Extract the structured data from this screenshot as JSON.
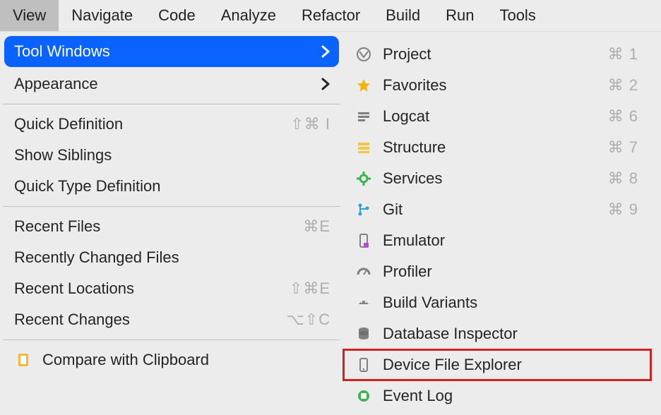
{
  "menubar": {
    "items": [
      {
        "label": "View",
        "active": true
      },
      {
        "label": "Navigate",
        "active": false
      },
      {
        "label": "Code",
        "active": false
      },
      {
        "label": "Analyze",
        "active": false
      },
      {
        "label": "Refactor",
        "active": false
      },
      {
        "label": "Build",
        "active": false
      },
      {
        "label": "Run",
        "active": false
      },
      {
        "label": "Tools",
        "active": false
      }
    ]
  },
  "left_menu": {
    "tool_windows": "Tool Windows",
    "appearance": "Appearance",
    "quick_definition": {
      "label": "Quick Definition",
      "shortcut": "⇧⌘ I"
    },
    "show_siblings": {
      "label": "Show Siblings",
      "shortcut": ""
    },
    "quick_type_definition": {
      "label": "Quick Type Definition",
      "shortcut": ""
    },
    "recent_files": {
      "label": "Recent Files",
      "shortcut": "⌘E"
    },
    "recently_changed": {
      "label": "Recently Changed Files",
      "shortcut": ""
    },
    "recent_locations": {
      "label": "Recent Locations",
      "shortcut": "⇧⌘E"
    },
    "recent_changes": {
      "label": "Recent Changes",
      "shortcut": "⌥⇧C"
    },
    "compare_clipboard": {
      "label": "Compare with Clipboard",
      "shortcut": ""
    }
  },
  "right_menu": {
    "project": {
      "label": "Project",
      "shortcut": "⌘ 1"
    },
    "favorites": {
      "label": "Favorites",
      "shortcut": "⌘ 2"
    },
    "logcat": {
      "label": "Logcat",
      "shortcut": "⌘ 6"
    },
    "structure": {
      "label": "Structure",
      "shortcut": "⌘ 7"
    },
    "services": {
      "label": "Services",
      "shortcut": "⌘ 8"
    },
    "git": {
      "label": "Git",
      "shortcut": "⌘ 9"
    },
    "emulator": {
      "label": "Emulator",
      "shortcut": ""
    },
    "profiler": {
      "label": "Profiler",
      "shortcut": ""
    },
    "build_variants": {
      "label": "Build Variants",
      "shortcut": ""
    },
    "db_inspector": {
      "label": "Database Inspector",
      "shortcut": ""
    },
    "device_explorer": {
      "label": "Device File Explorer",
      "shortcut": ""
    },
    "event_log": {
      "label": "Event Log",
      "shortcut": ""
    }
  }
}
